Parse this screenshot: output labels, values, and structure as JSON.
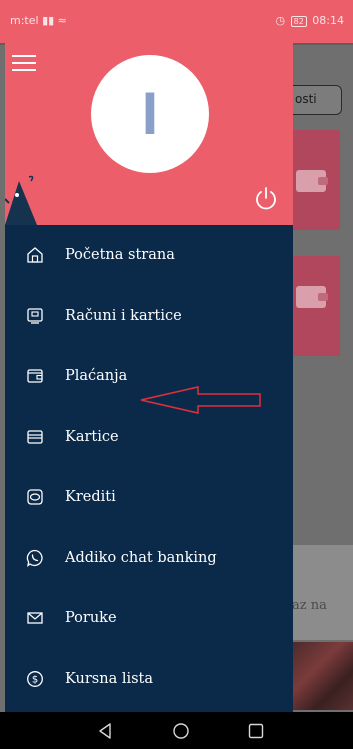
{
  "status_bar": {
    "carrier": "m:tel",
    "battery": "82",
    "time": "08:14"
  },
  "background": {
    "pill_label": "osti",
    "lower_text": "az na"
  },
  "drawer": {
    "avatar_letter": "I",
    "menu_items": [
      {
        "label": "Početna strana",
        "icon": "home-icon"
      },
      {
        "label": "Računi i kartice",
        "icon": "account-icon"
      },
      {
        "label": "Plaćanja",
        "icon": "wallet-icon"
      },
      {
        "label": "Kartice",
        "icon": "card-icon"
      },
      {
        "label": "Krediti",
        "icon": "loan-icon"
      },
      {
        "label": "Addiko chat banking",
        "icon": "viber-chat-icon"
      },
      {
        "label": "Poruke",
        "icon": "envelope-icon"
      },
      {
        "label": "Kursna lista",
        "icon": "dollar-coin-icon"
      }
    ]
  },
  "colors": {
    "accent_pink": "#ed5e6b",
    "drawer_navy": "#0b2a4a",
    "annotation_arrow": "#e0303a"
  }
}
